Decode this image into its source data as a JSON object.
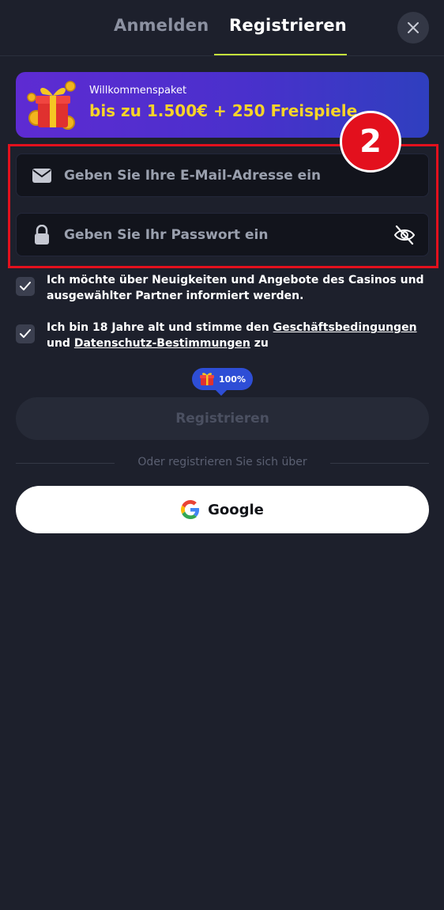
{
  "header": {
    "tab_login": "Anmelden",
    "tab_register": "Registrieren",
    "close_icon": "close-icon"
  },
  "promo": {
    "subtitle": "Willkommenspaket",
    "title": "bis zu 1.500€ + 250 Freispiele",
    "icon": "gift-icon"
  },
  "annotation": {
    "badge_number": "2",
    "color": "#e3101d"
  },
  "form": {
    "email_placeholder": "Geben Sie Ihre E-Mail-Adresse ein",
    "password_placeholder": "Geben Sie Ihr Passwort ein",
    "email_icon": "envelope-icon",
    "password_icon": "lock-icon",
    "visibility_icon": "eye-off-icon"
  },
  "checkboxes": {
    "newsletter_text": "Ich möchte über Neuigkeiten und Angebote des Casinos und ausgewählter Partner informiert werden.",
    "terms_prefix": "Ich bin 18 Jahre alt und stimme den ",
    "terms_link": "Geschäftsbedingungen",
    "terms_middle": " und ",
    "privacy_link": "Datenschutz-Bestimmungen",
    "terms_suffix": " zu",
    "newsletter_checked": true,
    "terms_checked": true
  },
  "progress": {
    "label": "100%",
    "icon": "gift-icon"
  },
  "actions": {
    "register_label": "Registrieren",
    "divider_text": "Oder registrieren Sie sich über",
    "google_label": "Google",
    "google_icon": "google-icon"
  },
  "colors": {
    "background": "#1d202c",
    "accent_underline": "#c4e43c",
    "promo_title": "#f8d428",
    "pill": "#2e4ed6"
  }
}
